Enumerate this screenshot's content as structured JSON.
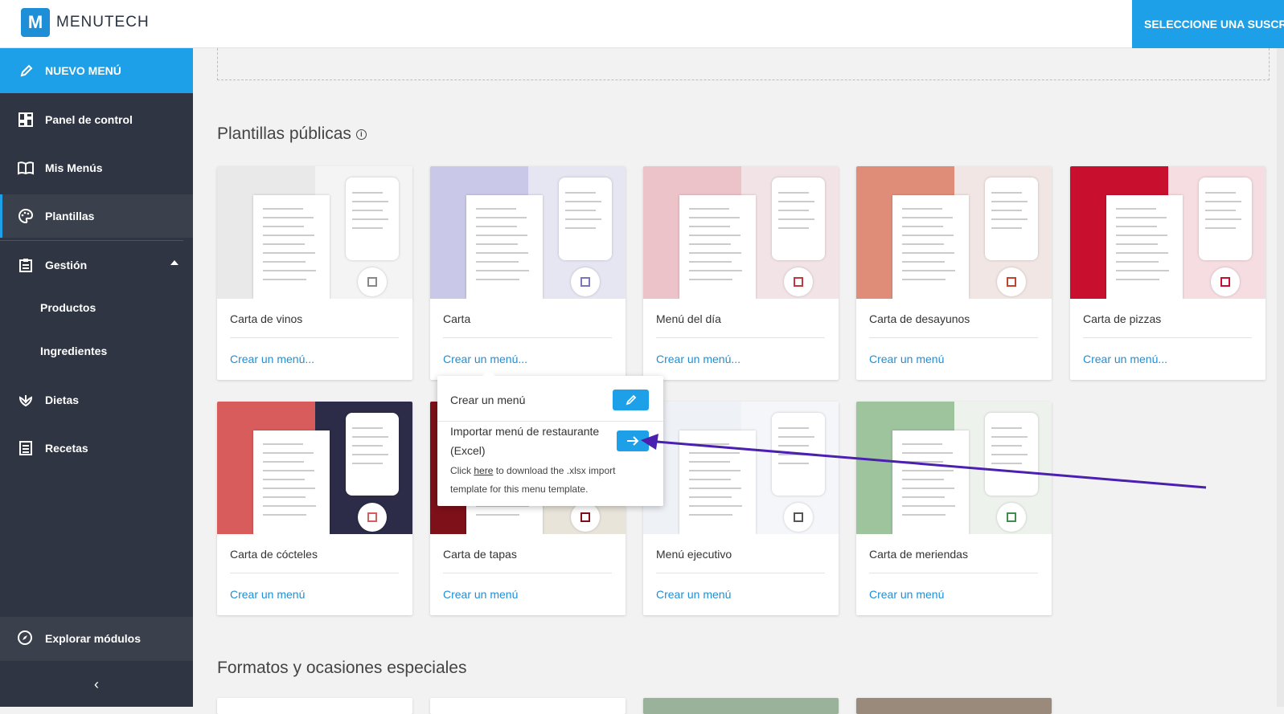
{
  "header": {
    "logo_letter": "M",
    "logo_text": "MENUTECH",
    "subscribe_label": "SELECCIONE UNA SUSCRIPCIÓN"
  },
  "sidebar": {
    "new_menu": "NUEVO MENÚ",
    "items": [
      {
        "label": "Panel de control",
        "icon": "dashboard-icon"
      },
      {
        "label": "Mis Menús",
        "icon": "book-icon"
      },
      {
        "label": "Plantillas",
        "icon": "palette-icon"
      },
      {
        "label": "Gestión",
        "icon": "clipboard-icon"
      },
      {
        "label": "Dietas",
        "icon": "leaf-icon"
      },
      {
        "label": "Recetas",
        "icon": "recipe-icon"
      }
    ],
    "sub_items": [
      "Productos",
      "Ingredientes"
    ],
    "explore": "Explorar módulos",
    "collapse_glyph": "‹"
  },
  "sections": {
    "public_templates": "Plantillas públicas",
    "formats": "Formatos y ocasiones especiales"
  },
  "cards": [
    {
      "name": "Carta de vinos",
      "link": "Crear un menú...",
      "bg_left": "#e9e9e9",
      "bg_right": "#f4f4f4",
      "qr_color": "#888888"
    },
    {
      "name": "Carta",
      "link": "Crear un menú...",
      "bg_left": "#c9c8e8",
      "bg_right": "#e6e6f3",
      "qr_color": "#7a79b8"
    },
    {
      "name": "Menú del día",
      "link": "Crear un menú...",
      "bg_left": "#ecc3c9",
      "bg_right": "#f2e4e6",
      "qr_color": "#c0393f"
    },
    {
      "name": "Carta de desayunos",
      "link": "Crear un menú",
      "bg_left": "#df8d79",
      "bg_right": "#f1e6e3",
      "qr_color": "#c0452e"
    },
    {
      "name": "Carta de pizzas",
      "link": "Crear un menú...",
      "bg_left": "#c8102e",
      "bg_right": "#f6dde2",
      "qr_color": "#c8102e"
    },
    {
      "name": "Carta de cócteles",
      "link": "Crear un menú",
      "bg_left": "#d95c5c",
      "bg_right": "#2c2c48",
      "qr_color": "#d95c5c"
    },
    {
      "name": "Carta de tapas",
      "link": "Crear un menú",
      "bg_left": "#7d1018",
      "bg_right": "#e8e4da",
      "qr_color": "#7d1018"
    },
    {
      "name": "Menú ejecutivo",
      "link": "Crear un menú",
      "bg_left": "#eef1f6",
      "bg_right": "#f5f6f9",
      "qr_color": "#555555"
    },
    {
      "name": "Carta de meriendas",
      "link": "Crear un menú",
      "bg_left": "#9ec49d",
      "bg_right": "#edf2ec",
      "qr_color": "#3f8e4e"
    }
  ],
  "popover": {
    "create_label": "Crear un menú",
    "import_label": "Importar menú de restaurante (Excel)",
    "help_prefix": "Click",
    "help_link": "here",
    "help_suffix": "to download the .xlsx import template for this menu template."
  },
  "colors": {
    "accent": "#1ea0e8",
    "sidebar_bg": "#2f3542",
    "link": "#1e8fd6",
    "annotation_arrow": "#4b1fb0"
  }
}
